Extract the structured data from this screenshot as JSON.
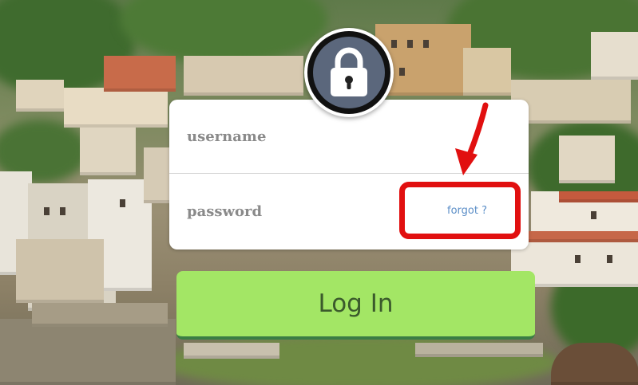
{
  "login_form": {
    "username_placeholder": "username",
    "password_placeholder": "password",
    "forgot_label": "forgot ?",
    "login_label": "Log In"
  },
  "icons": {
    "lock": "lock-icon"
  },
  "colors": {
    "login_button": "#a3e665",
    "login_button_border": "#3a7d44",
    "forgot_link": "#5b8ec7",
    "annotation": "#e11010",
    "lock_badge": "#5b677c"
  }
}
